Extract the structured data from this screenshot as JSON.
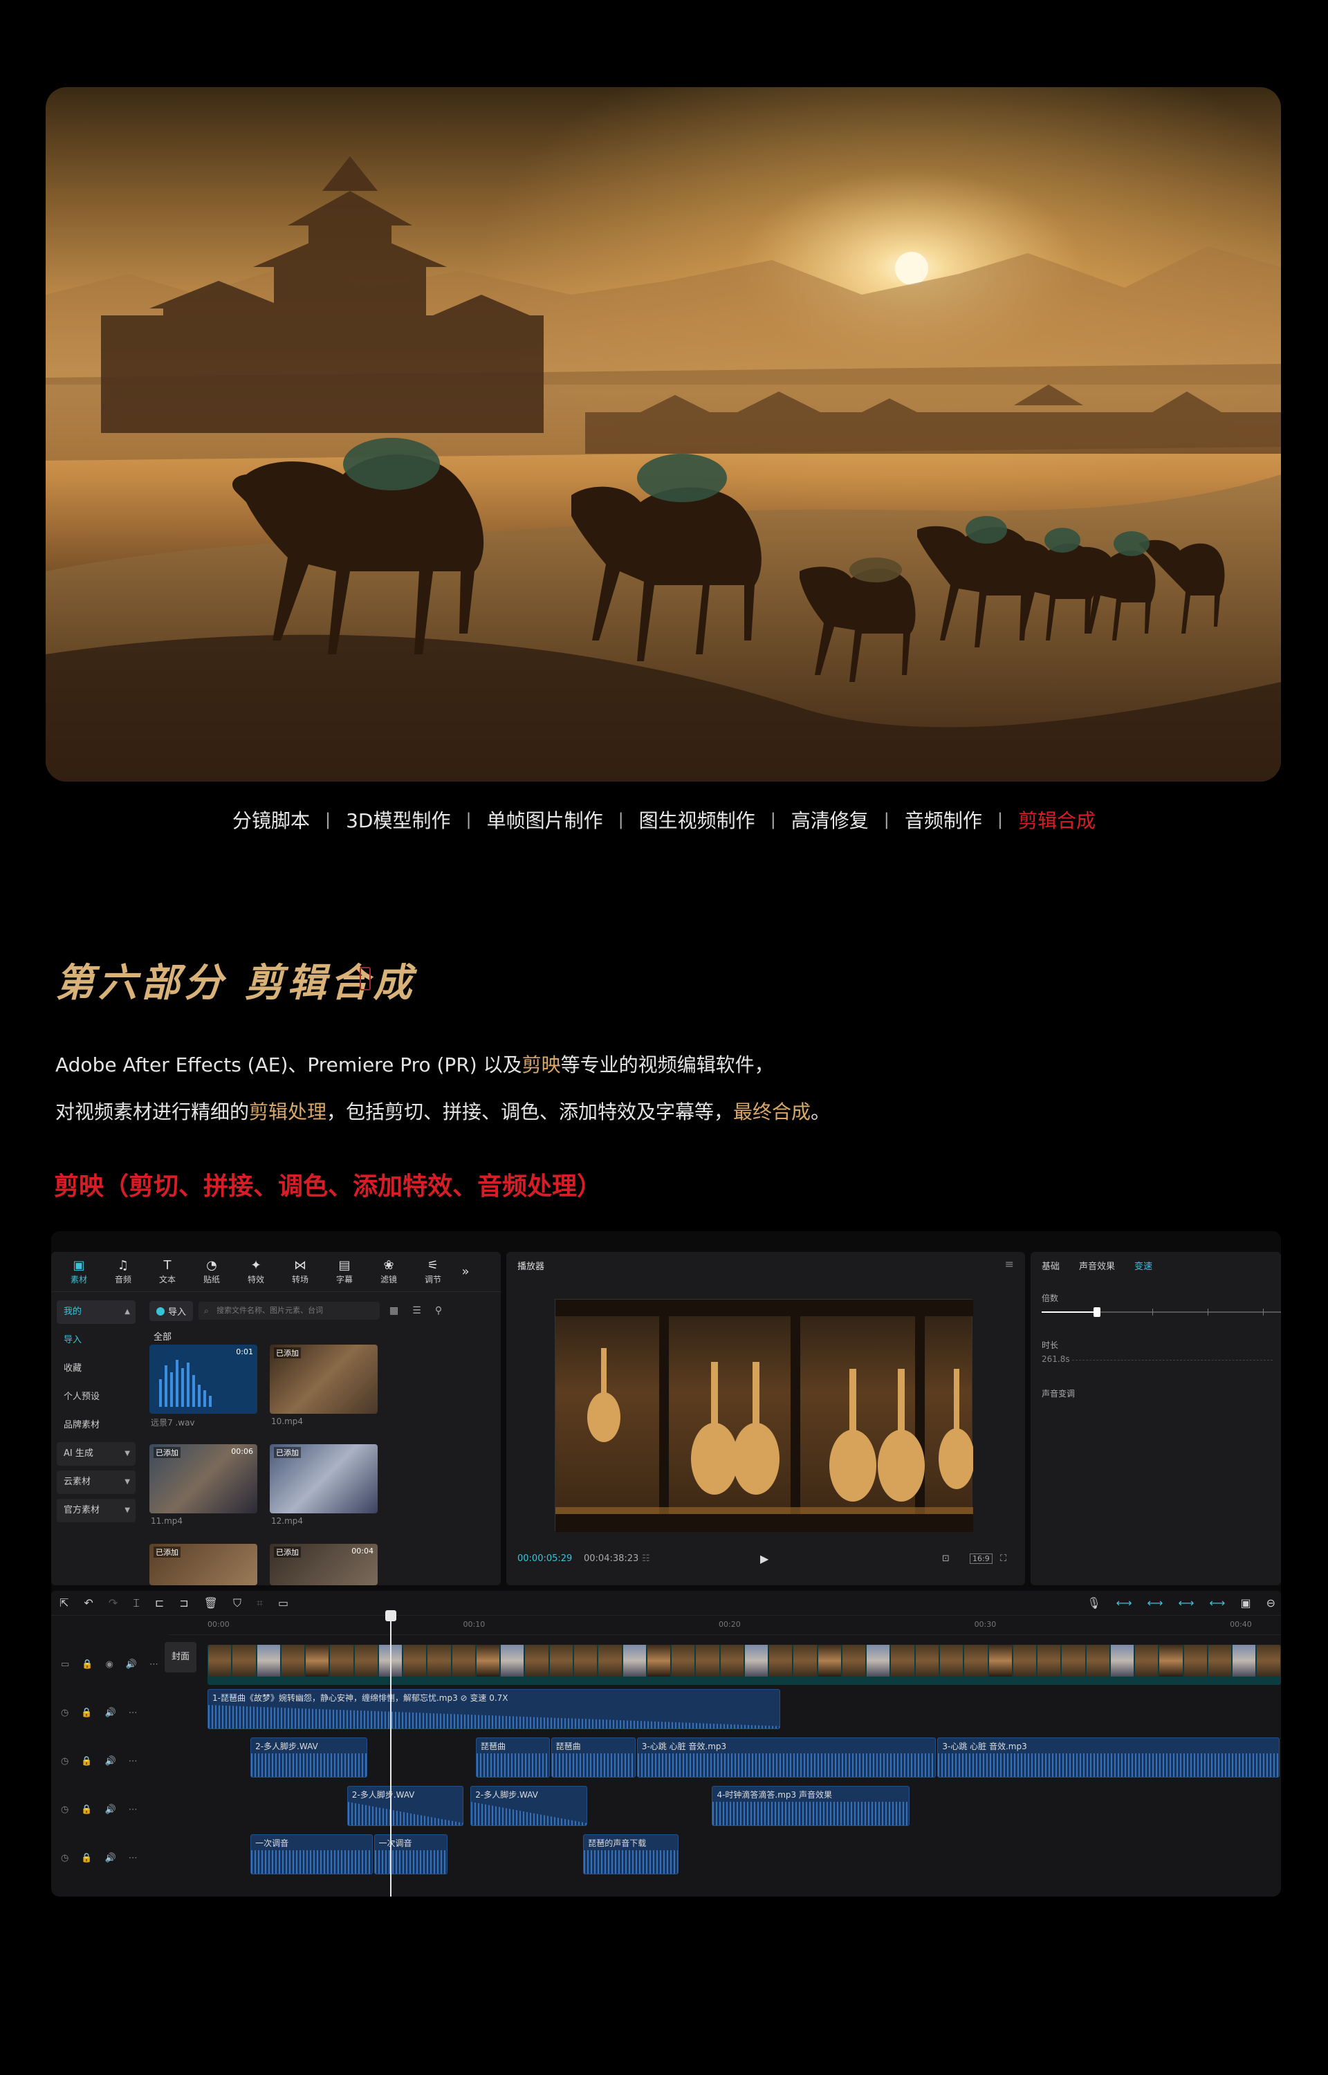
{
  "hero": {
    "alt": "沙漠驼队夕阳古城"
  },
  "nav": {
    "items": [
      "分镜脚本",
      "3D模型制作",
      "单帧图片制作",
      "图生视频制作",
      "高清修复",
      "音频制作",
      "剪辑合成"
    ],
    "active_index": 6,
    "separator": "|"
  },
  "section": {
    "title": "第六部分 剪辑合成",
    "para1": {
      "a": "Adobe After Effects (AE)、Premiere Pro (PR) 以及",
      "b": "剪映",
      "c": "等专业的视频编辑软件，"
    },
    "para2": {
      "a": "对视频素材进行精细的",
      "b": "剪辑处理",
      "c": "，包括剪切、拼接、调色、添加特效及字幕等，",
      "d": "最终合成",
      "e": "。"
    },
    "subtitle": "剪映（剪切、拼接、调色、添加特效、音频处理）"
  },
  "editor": {
    "colors": {
      "accent": "#39c3d9",
      "audio_clip": "#18355e",
      "video_track": "#0c3c3f",
      "highlight_red": "#d81d26",
      "highlight_gold": "#d9a766"
    },
    "toolbar": [
      {
        "label": "素材",
        "icon": "media-icon"
      },
      {
        "label": "音频",
        "icon": "audio-icon"
      },
      {
        "label": "文本",
        "icon": "text-icon"
      },
      {
        "label": "贴纸",
        "icon": "sticker-icon"
      },
      {
        "label": "特效",
        "icon": "effects-icon"
      },
      {
        "label": "转场",
        "icon": "transition-icon"
      },
      {
        "label": "字幕",
        "icon": "caption-icon"
      },
      {
        "label": "滤镜",
        "icon": "filter-icon"
      },
      {
        "label": "调节",
        "icon": "adjust-icon"
      }
    ],
    "sidebar": [
      "我的",
      "导入",
      "收藏",
      "个人预设",
      "品牌素材",
      "AI 生成",
      "云素材",
      "官方素材"
    ],
    "import_label": "导入",
    "search_placeholder": "搜索文件名称、图片元素、台词",
    "all_tab": "全部",
    "media": [
      {
        "name": "远景7 .wav",
        "tag": "",
        "duration": "0:01"
      },
      {
        "name": "10.mp4",
        "tag": "已添加",
        "duration": ""
      },
      {
        "name": "11.mp4",
        "tag": "已添加",
        "duration": "00:06"
      },
      {
        "name": "12.mp4",
        "tag": "已添加",
        "duration": ""
      },
      {
        "name": "",
        "tag": "已添加",
        "duration": ""
      },
      {
        "name": "",
        "tag": "已添加",
        "duration": "00:04"
      }
    ],
    "player": {
      "title": "播放器",
      "current_time": "00:00:05:29",
      "total_time": "00:04:38:23",
      "ratio": "16:9"
    },
    "attributes": {
      "tabs": [
        "基础",
        "声音效果",
        "变速"
      ],
      "active_tab": 2,
      "speed_label": "倍数",
      "duration_label": "时长",
      "duration_value": "261.8s",
      "pitch_label": "声音变调",
      "speed_level": 0.23
    },
    "timeline": {
      "ruler": [
        "00:00",
        "00:10",
        "00:20",
        "00:30",
        "00:40"
      ],
      "cover_label": "封面",
      "playhead_fraction": 0.17,
      "audio_clips": [
        {
          "track": 1,
          "label": "1-琵琶曲《故梦》婉转幽怨，静心安神，缠绵悱恻，解郁忘忧.mp3   ⊘ 变速 0.7X",
          "start": 0.0,
          "end": 0.535,
          "shape": "tri"
        },
        {
          "track": 2,
          "label": "2-多人脚步.WAV",
          "start": 0.04,
          "end": 0.15,
          "shape": "wave"
        },
        {
          "track": 2,
          "label": "琵琶曲",
          "start": 0.25,
          "end": 0.32,
          "shape": "wave"
        },
        {
          "track": 2,
          "label": "琵琶曲",
          "start": 0.32,
          "end": 0.4,
          "shape": "wave"
        },
        {
          "track": 2,
          "label": "3-心跳 心脏 音效.mp3",
          "start": 0.4,
          "end": 0.68,
          "shape": "wave"
        },
        {
          "track": 2,
          "label": "3-心跳 心脏 音效.mp3",
          "start": 0.68,
          "end": 1.0,
          "shape": "wave"
        },
        {
          "track": 3,
          "label": "2-多人脚步.WAV",
          "start": 0.13,
          "end": 0.24,
          "shape": "tri"
        },
        {
          "track": 3,
          "label": "2-多人脚步.WAV",
          "start": 0.245,
          "end": 0.355,
          "shape": "tri"
        },
        {
          "track": 3,
          "label": "4-时钟滴答滴答.mp3   声音效果",
          "start": 0.47,
          "end": 0.655,
          "shape": "wave"
        },
        {
          "track": 4,
          "label": "一次调音",
          "start": 0.04,
          "end": 0.155,
          "shape": "wave"
        },
        {
          "track": 4,
          "label": "一次调音",
          "start": 0.155,
          "end": 0.225,
          "shape": "wave"
        },
        {
          "track": 4,
          "label": "琵琶的声音下载",
          "start": 0.35,
          "end": 0.44,
          "shape": "wave"
        }
      ]
    }
  }
}
